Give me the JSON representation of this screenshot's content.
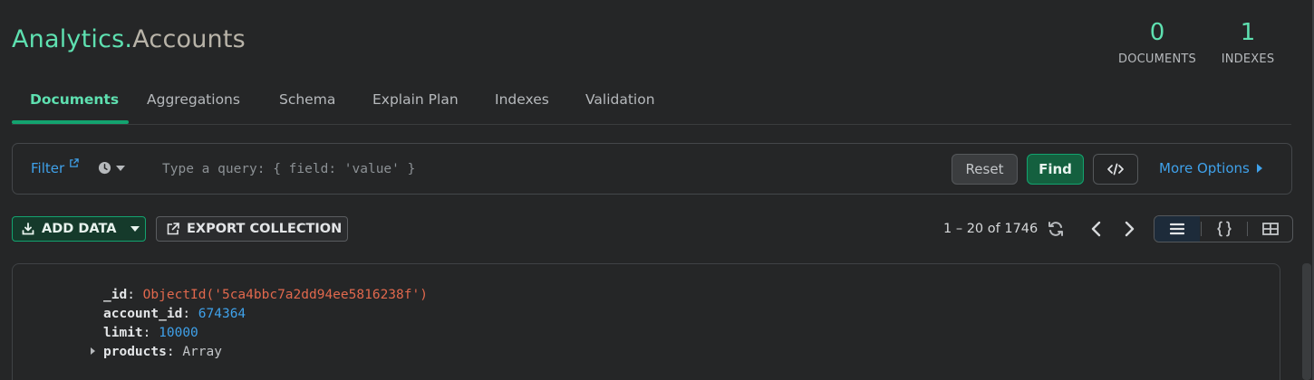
{
  "header": {
    "database": "Analytics",
    "separator": ".",
    "collection": "Accounts"
  },
  "stats": [
    {
      "value": "0",
      "label": "DOCUMENTS"
    },
    {
      "value": "1",
      "label": "INDEXES"
    }
  ],
  "tabs": [
    {
      "label": "Documents",
      "active": true
    },
    {
      "label": "Aggregations"
    },
    {
      "label": "Schema"
    },
    {
      "label": "Explain Plan"
    },
    {
      "label": "Indexes"
    },
    {
      "label": "Validation"
    }
  ],
  "filter": {
    "label": "Filter",
    "placeholder": "Type a query: { field: 'value' }",
    "reset_label": "Reset",
    "find_label": "Find",
    "more_options_label": "More Options"
  },
  "toolbar": {
    "add_data_label": "ADD DATA",
    "export_label": "EXPORT COLLECTION",
    "pager_text": "1 – 20 of 1746"
  },
  "document": {
    "fields": [
      {
        "key": "_id",
        "value": "ObjectId('5ca4bbc7a2dd94ee5816238f')",
        "type": "oid"
      },
      {
        "key": "account_id",
        "value": "674364",
        "type": "num"
      },
      {
        "key": "limit",
        "value": "10000",
        "type": "num"
      },
      {
        "key": "products",
        "value": "Array",
        "type": "arr",
        "expandable": true
      }
    ]
  },
  "colors": {
    "accent": "#5ee0b0",
    "link": "#3fa1ea",
    "oid": "#e0684d"
  }
}
